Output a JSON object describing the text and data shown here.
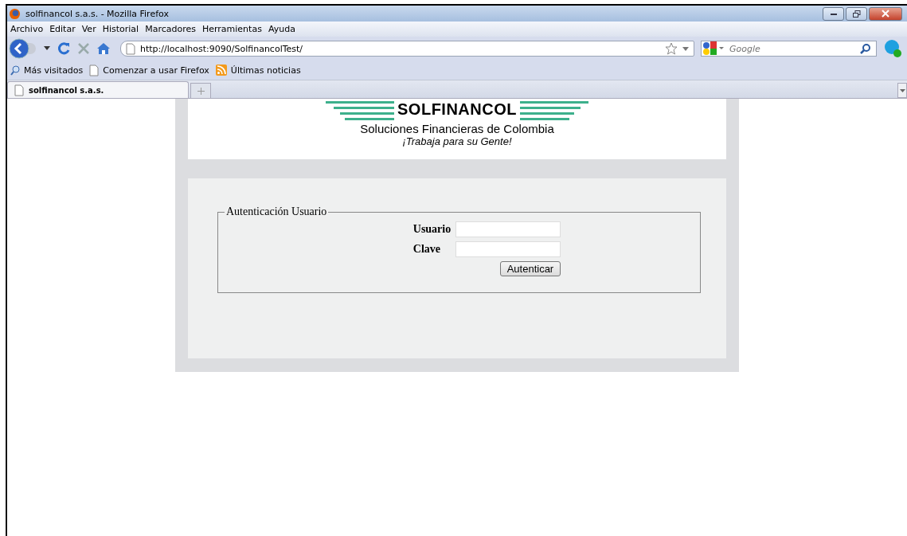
{
  "window": {
    "title": "solfinancol s.a.s. - Mozilla Firefox"
  },
  "menu": [
    {
      "label": "Archivo"
    },
    {
      "label": "Editar"
    },
    {
      "label": "Ver"
    },
    {
      "label": "Historial"
    },
    {
      "label": "Marcadores"
    },
    {
      "label": "Herramientas"
    },
    {
      "label": "Ayuda"
    }
  ],
  "address": {
    "value": "http://localhost:9090/SolfinancolTest/"
  },
  "search": {
    "placeholder": "Google"
  },
  "bookmarks": [
    {
      "label": "Más visitados",
      "kind": "search"
    },
    {
      "label": "Comenzar a usar Firefox",
      "kind": "page"
    },
    {
      "label": "Últimas noticias",
      "kind": "feed"
    }
  ],
  "tabs": [
    {
      "label": "solfinancol s.a.s.",
      "selected": true
    }
  ],
  "page": {
    "logo": {
      "name": "SOLFINANCOL",
      "subtitle": "Soluciones Financieras de Colombia",
      "slogan": "¡Trabaja para su Gente!"
    },
    "form": {
      "legend": "Autenticación Usuario",
      "fields": [
        {
          "label": "Usuario"
        },
        {
          "label": "Clave"
        }
      ],
      "submit": "Autenticar"
    }
  }
}
